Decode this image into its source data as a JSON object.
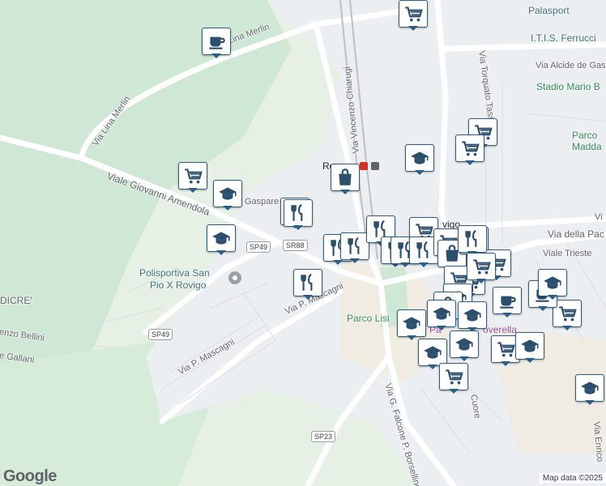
{
  "streets": [
    {
      "text": "Via Lina Merlin"
    },
    {
      "text": "Via Lina Merlin"
    },
    {
      "text": "Viale Giovanni Amendola"
    },
    {
      "text": "Via Vincenzo Chiarugi"
    },
    {
      "text": "Via Torquato Tasso"
    },
    {
      "text": "Via Alcide de Gaspe"
    },
    {
      "text": "Via della Pac"
    },
    {
      "text": "Viale Trieste"
    },
    {
      "text": "Via P. Mascagni"
    },
    {
      "text": "Via P. Mascagni"
    },
    {
      "text": "Via G. Falcone P. Borsellino"
    },
    {
      "text": "Gaspare Ca"
    },
    {
      "text": "enzo Bellini"
    },
    {
      "text": "e Gallani"
    },
    {
      "text": "DICRE'"
    },
    {
      "text": "Cuore"
    },
    {
      "text": "Via Enrico"
    },
    {
      "text": "Vi"
    }
  ],
  "places": [
    {
      "text": "Palasport",
      "style": "poi"
    },
    {
      "text": "I.T.I.S. Ferrucci",
      "style": "poi"
    },
    {
      "text": "Stadio Mario B",
      "style": "green"
    },
    {
      "text": "Parco",
      "style": "green"
    },
    {
      "text": "Madda",
      "style": "green"
    },
    {
      "text": "Polisportiva San",
      "style": "poi"
    },
    {
      "text": "Pio X Rovigo",
      "style": "poi"
    },
    {
      "text": "Parco Lisi",
      "style": "green"
    },
    {
      "text": "Pa",
      "style": "purple"
    },
    {
      "text": "overella",
      "style": "purple"
    },
    {
      "text": "Ro",
      "style": "dark"
    },
    {
      "text": "vigo",
      "style": "dark"
    }
  ],
  "shields": [
    {
      "text": "SP49"
    },
    {
      "text": "SR88"
    },
    {
      "text": "SP49"
    },
    {
      "text": "SP23"
    }
  ],
  "markers": [
    {
      "icon": "cart-icon",
      "type": "supermarket"
    },
    {
      "icon": "coffee-icon",
      "type": "cafe"
    },
    {
      "icon": "cart-icon",
      "type": "supermarket"
    },
    {
      "icon": "cart-icon",
      "type": "supermarket"
    },
    {
      "icon": "school-icon",
      "type": "school"
    },
    {
      "icon": "bag-icon",
      "type": "shop"
    },
    {
      "icon": "cart-icon",
      "type": "supermarket"
    },
    {
      "icon": "school-icon",
      "type": "school"
    },
    {
      "icon": "restaurant-icon",
      "type": "restaurant"
    },
    {
      "icon": "restaurant-icon",
      "type": "restaurant"
    },
    {
      "icon": "school-icon",
      "type": "school"
    },
    {
      "icon": "restaurant-icon",
      "type": "restaurant"
    },
    {
      "icon": "restaurant-icon",
      "type": "restaurant"
    },
    {
      "icon": "restaurant-icon",
      "type": "restaurant"
    },
    {
      "icon": "restaurant-icon",
      "type": "restaurant"
    },
    {
      "icon": "restaurant-icon",
      "type": "restaurant"
    },
    {
      "icon": "restaurant-icon",
      "type": "restaurant"
    },
    {
      "icon": "cart-icon",
      "type": "supermarket"
    },
    {
      "icon": "restaurant-icon",
      "type": "restaurant"
    },
    {
      "icon": "cart-icon",
      "type": "supermarket"
    },
    {
      "icon": "bag-icon",
      "type": "shop"
    },
    {
      "icon": "bag-icon",
      "type": "shop"
    },
    {
      "icon": "cart-icon",
      "type": "supermarket"
    },
    {
      "icon": "restaurant-icon",
      "type": "restaurant"
    },
    {
      "icon": "cart-icon",
      "type": "supermarket"
    },
    {
      "icon": "cart-icon",
      "type": "supermarket"
    },
    {
      "icon": "school-icon",
      "type": "school"
    },
    {
      "icon": "bag-icon",
      "type": "shop"
    },
    {
      "icon": "school-icon",
      "type": "school"
    },
    {
      "icon": "school-icon",
      "type": "school"
    },
    {
      "icon": "school-icon",
      "type": "school"
    },
    {
      "icon": "school-icon",
      "type": "school"
    },
    {
      "icon": "school-icon",
      "type": "school"
    },
    {
      "icon": "coffee-icon",
      "type": "cafe"
    },
    {
      "icon": "cart-icon",
      "type": "supermarket"
    },
    {
      "icon": "cart-icon",
      "type": "supermarket"
    },
    {
      "icon": "coffee-icon",
      "type": "cafe"
    },
    {
      "icon": "school-icon",
      "type": "school"
    },
    {
      "icon": "school-icon",
      "type": "school"
    },
    {
      "icon": "school-icon",
      "type": "school"
    },
    {
      "icon": "cart-icon",
      "type": "supermarket"
    },
    {
      "icon": "cart-icon",
      "type": "supermarket"
    }
  ],
  "attribution": {
    "logo": "Google",
    "credit": "Map data ©2025"
  },
  "colors": {
    "land": "#e8eaed",
    "park": "#d4ecd9",
    "urban": "#f1f3f4",
    "road": "#ffffff",
    "marker_border": "#2d5e86",
    "marker_icon": "#2d4f6e"
  }
}
